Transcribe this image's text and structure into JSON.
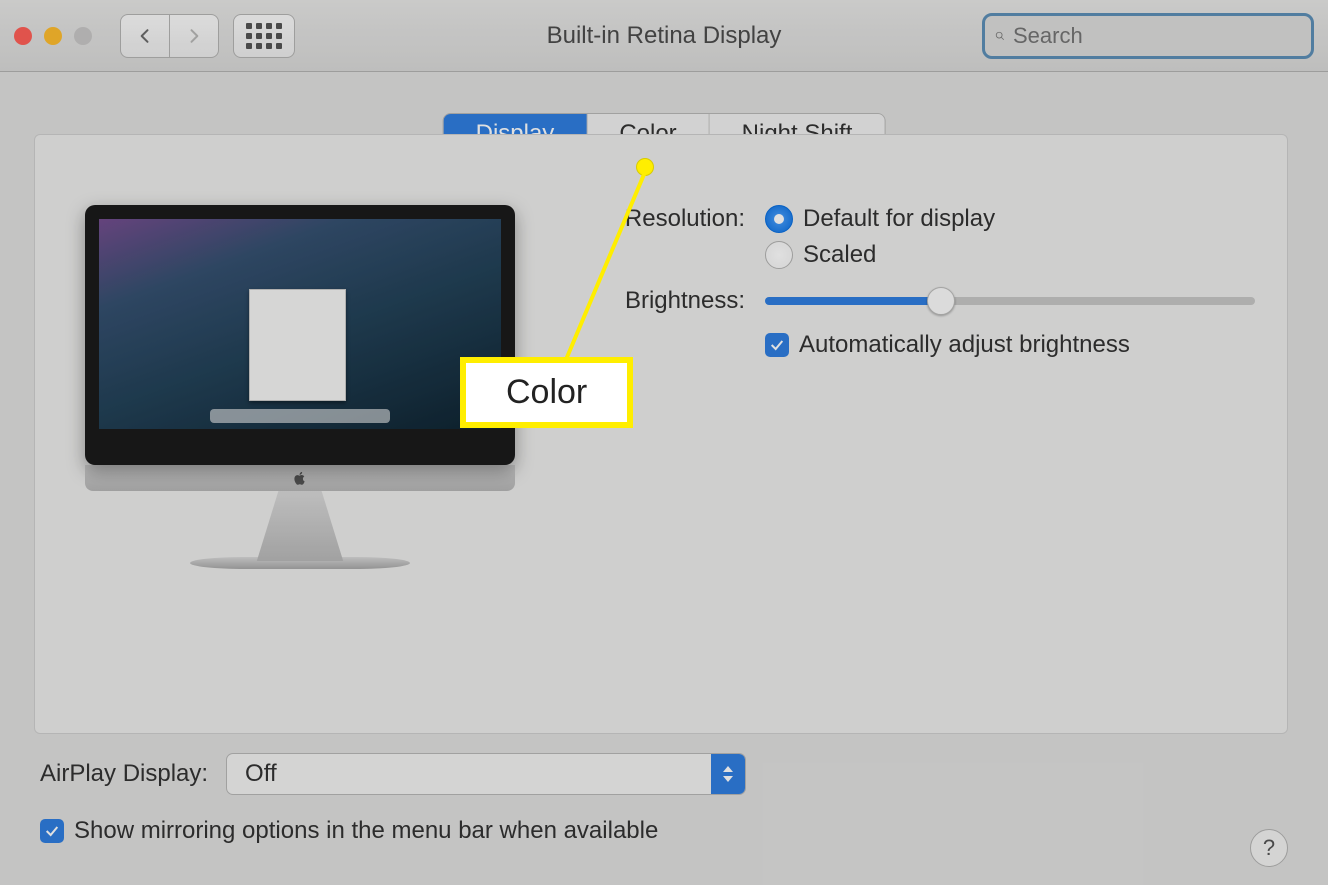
{
  "window": {
    "title": "Built-in Retina Display"
  },
  "search": {
    "placeholder": "Search"
  },
  "tabs": {
    "display": "Display",
    "color": "Color",
    "night": "Night Shift"
  },
  "settings": {
    "resolution_label": "Resolution:",
    "brightness_label": "Brightness:",
    "radio_default": "Default for display",
    "radio_scaled": "Scaled",
    "auto_brightness": "Automatically adjust brightness",
    "brightness_value": 34
  },
  "footer": {
    "airplay_label": "AirPlay Display:",
    "airplay_value": "Off",
    "mirroring": "Show mirroring options in the menu bar when available"
  },
  "callout": {
    "text": "Color"
  }
}
